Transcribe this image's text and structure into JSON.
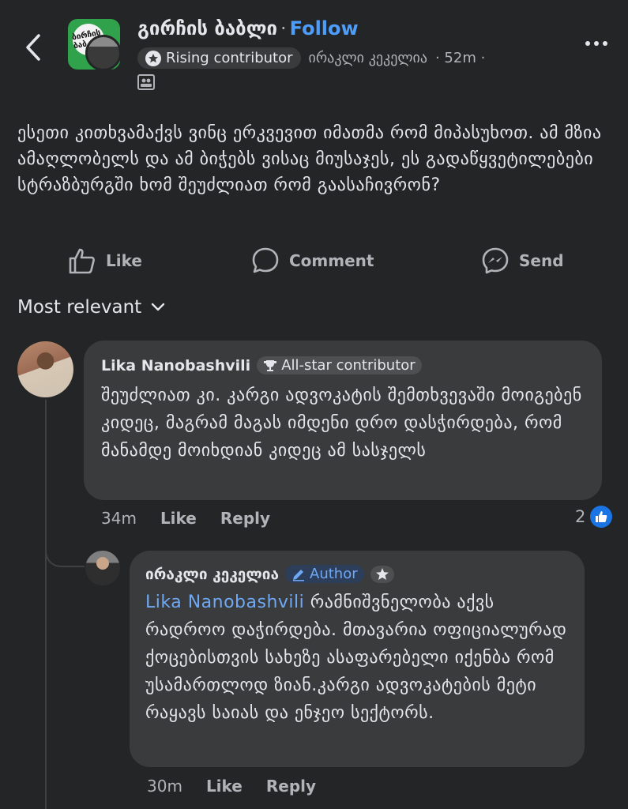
{
  "header": {
    "group_name": "გირჩის ბაბლი",
    "separator": "·",
    "follow_label": "Follow",
    "group_avatar_text": "ბირჩის ბაბ",
    "badge_label": "Rising contributor",
    "author_name": "ირაკლი კეკელია",
    "time": "· 52m ·"
  },
  "post": {
    "text": "ესეთი კითხვამაქვს ვინც ერკვევით იმათმა რომ მიპასუხოთ. ამ მზია ამაღლობელს და ამ ბიჭებს ვისაც მიუსაჯეს, ეს გადაწყვეტილებები სტრაზბურგში ხომ შეუძლიათ რომ გაასაჩივრონ?"
  },
  "actions": {
    "like": "Like",
    "comment": "Comment",
    "send": "Send"
  },
  "sort": {
    "label": "Most relevant"
  },
  "comments": [
    {
      "author": "Lika Nanobashvili",
      "badge": "All-star contributor",
      "text": "შეუძლიათ კი. კარგი ადვოკატის შემთხვევაში მოიგებენ კიდეც, მაგრამ მაგას იმდენი დრო დასჭირდება, რომ მანამდე მოიხდიან კიდეც ამ სასჯელს",
      "time": "34m",
      "like": "Like",
      "reply": "Reply",
      "reaction_count": "2"
    },
    {
      "author": "ირაკლი კეკელია",
      "badge": "Author",
      "mention": "Lika Nanobashvili",
      "text": " რამნიშვნელობა აქვს რადროო დაჭირდება. მთავარია ოფიციალურად ქოცებისთვის სახეზე ასაფარებელი იქენბა რომ უსამართლოდ ზიან.კარგი ადვოკატების მეტი რაყავს საიას და ენჯეო სექტორს.",
      "time": "30m",
      "like": "Like",
      "reply": "Reply"
    }
  ],
  "colors": {
    "background": "#242526",
    "bubble": "#3a3b3c",
    "link": "#4d9dfa",
    "like_blue": "#1b74e4"
  }
}
